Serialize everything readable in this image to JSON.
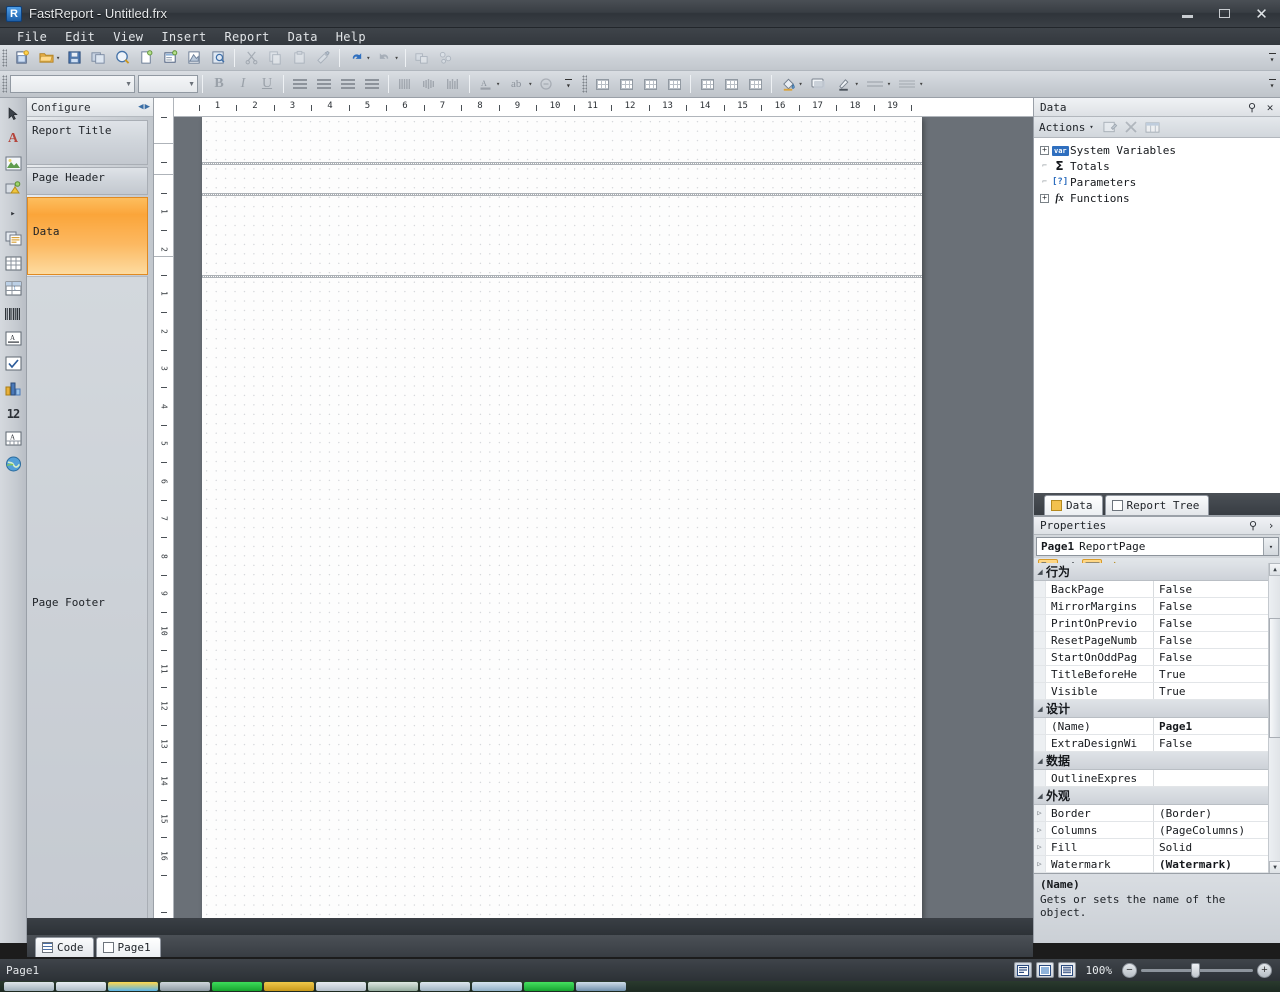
{
  "window": {
    "title": "FastReport - Untitled.frx",
    "app_icon": "R",
    "minimize_label": "Minimize",
    "maximize_label": "Maximize",
    "close_label": "✕"
  },
  "menubar": {
    "items": [
      {
        "label": "File"
      },
      {
        "label": "Edit"
      },
      {
        "label": "View"
      },
      {
        "label": "Insert"
      },
      {
        "label": "Report"
      },
      {
        "label": "Data"
      },
      {
        "label": "Help"
      }
    ]
  },
  "toolbar_main": {
    "buttons": [
      {
        "name": "new-report-button",
        "glyph": "▤"
      },
      {
        "name": "open-report-button",
        "glyph": "📂"
      },
      {
        "name": "open-dropdown-button",
        "glyph": "▾"
      },
      {
        "name": "save-report-button",
        "glyph": "💾"
      },
      {
        "name": "save-all-button",
        "glyph": "▤"
      },
      {
        "name": "preview-button",
        "glyph": "◐"
      },
      {
        "name": "new-page-button",
        "glyph": "▯"
      },
      {
        "name": "new-dialog-button",
        "glyph": "▤"
      },
      {
        "name": "page-setup-button",
        "glyph": "◺"
      },
      {
        "name": "report-settings-button",
        "glyph": "◎"
      },
      {
        "name": "cut-button",
        "glyph": "✂"
      },
      {
        "name": "copy-button",
        "glyph": "❐"
      },
      {
        "name": "paste-button",
        "glyph": "📋"
      },
      {
        "name": "format-painter-button",
        "glyph": "🖌"
      },
      {
        "name": "undo-button",
        "glyph": "↶"
      },
      {
        "name": "undo-dropdown-button",
        "glyph": "▾"
      },
      {
        "name": "redo-button",
        "glyph": "↷"
      },
      {
        "name": "redo-dropdown-button",
        "glyph": "▾"
      },
      {
        "name": "group-button",
        "glyph": "❏"
      },
      {
        "name": "ungroup-button",
        "glyph": "❖"
      }
    ],
    "overflow_label": "▾"
  },
  "toolbar_format": {
    "font_name": "",
    "font_name_placeholder": "",
    "font_size": "",
    "font_size_placeholder": "",
    "bold_label": "B",
    "italic_label": "I",
    "underline_label": "U",
    "align_left_label": "Align Left",
    "align_center_label": "Align Center",
    "align_right_label": "Align Right",
    "align_justify_label": "Justify",
    "valign_top_label": "Top",
    "valign_middle_label": "Middle",
    "valign_bottom_label": "Bottom",
    "font_color_label": "A",
    "style_label": "ab",
    "overflow_label": "▾"
  },
  "toolbar_frame": {
    "buttons": [
      {
        "name": "border-all-button"
      },
      {
        "name": "border-outside-button"
      },
      {
        "name": "border-inside-button"
      },
      {
        "name": "border-none-button"
      },
      {
        "name": "border-top-button"
      },
      {
        "name": "border-bottom-button"
      },
      {
        "name": "border-custom-button"
      }
    ],
    "fill_color_label": "Fill Color",
    "shadow_label": "Shadow",
    "line_color_label": "Line Color",
    "line_style_label": "Line Style",
    "line_width_label": "Line Width",
    "overflow_label": "▾"
  },
  "toolbox": {
    "tools": [
      {
        "name": "select-tool",
        "glyph": "➤",
        "selected": false
      },
      {
        "name": "text-object-tool",
        "glyph": "A",
        "selected": false
      },
      {
        "name": "picture-object-tool",
        "glyph": "▣",
        "selected": false
      },
      {
        "name": "shape-object-tool",
        "glyph": "◭",
        "selected": false
      },
      {
        "name": "line-object-tool",
        "glyph": "▸",
        "selected": false
      },
      {
        "name": "subreport-object-tool",
        "glyph": "❐",
        "selected": false
      },
      {
        "name": "table-object-tool",
        "glyph": "▦",
        "selected": false
      },
      {
        "name": "matrix-object-tool",
        "glyph": "▩",
        "selected": false
      },
      {
        "name": "barcode-object-tool",
        "glyph": "▥",
        "selected": false
      },
      {
        "name": "richtext-object-tool",
        "glyph": "Ａ",
        "selected": false
      },
      {
        "name": "checkbox-object-tool",
        "glyph": "✔",
        "selected": false
      },
      {
        "name": "chart-object-tool",
        "glyph": "▊",
        "selected": false
      },
      {
        "name": "zipcode-object-tool",
        "glyph": "12",
        "selected": false
      },
      {
        "name": "cellular-text-tool",
        "glyph": "Ⓐ",
        "selected": false
      },
      {
        "name": "map-object-tool",
        "glyph": "🌐",
        "selected": false
      }
    ]
  },
  "designer": {
    "band_panel_title": "Configure",
    "prev_arrow": "◀",
    "next_arrow": "▶",
    "bands": [
      {
        "name": "report-title-band",
        "label": "Report Title",
        "selected": false
      },
      {
        "name": "page-header-band",
        "label": "Page Header",
        "selected": false
      },
      {
        "name": "data-band",
        "label": "Data",
        "selected": true
      },
      {
        "name": "page-footer-band",
        "label": "Page Footer",
        "selected": false
      }
    ],
    "hruler_units": [
      1,
      2,
      3,
      4,
      5,
      6,
      7,
      8,
      9,
      10,
      11,
      12,
      13,
      14,
      15,
      16,
      17,
      18,
      19
    ],
    "vruler_units": [
      1,
      2,
      1,
      2,
      3,
      4,
      5,
      6,
      7,
      8,
      9,
      10,
      11,
      12,
      13,
      14,
      15,
      16
    ],
    "tabs": [
      {
        "name": "tab-code",
        "label": "Code",
        "icon": "code-icon",
        "active": false
      },
      {
        "name": "tab-page1",
        "label": "Page1",
        "icon": "page-icon",
        "active": true
      }
    ]
  },
  "data_panel": {
    "title": "Data",
    "pin_label": "⚲",
    "close_label": "✕",
    "actions_label": "Actions",
    "actions_caret": "▾",
    "action_buttons": [
      {
        "name": "edit-datasource-button",
        "glyph": "✎"
      },
      {
        "name": "delete-datasource-button",
        "glyph": "✕"
      },
      {
        "name": "view-data-button",
        "glyph": "▦"
      }
    ],
    "tree": [
      {
        "name": "node-system-variables",
        "label": "System Variables",
        "expander": "+",
        "icon": "var-badge-icon",
        "icon_text": "var"
      },
      {
        "name": "node-totals",
        "label": "Totals",
        "expander": "",
        "icon": "sigma-icon",
        "icon_text": "Σ"
      },
      {
        "name": "node-parameters",
        "label": "Parameters",
        "expander": "",
        "icon": "parameter-icon",
        "icon_text": "[?]"
      },
      {
        "name": "node-functions",
        "label": "Functions",
        "expander": "+",
        "icon": "function-icon",
        "icon_text": "fx"
      }
    ],
    "tabs": [
      {
        "name": "dock-tab-data",
        "label": "Data",
        "active": true
      },
      {
        "name": "dock-tab-report-tree",
        "label": "Report Tree",
        "active": false
      }
    ]
  },
  "properties_panel": {
    "title": "Properties",
    "pin_label": "⚲",
    "close_label": "›",
    "selected_object_name": "Page1",
    "selected_object_type": "ReportPage",
    "dropdown_label": "▾",
    "toolbar": [
      {
        "name": "categorized-view-button",
        "glyph": "▤",
        "active": true
      },
      {
        "name": "alphabetical-view-button",
        "glyph": "A↓",
        "active": false
      },
      {
        "name": "properties-view-button",
        "glyph": "▥",
        "active": true
      },
      {
        "name": "events-view-button",
        "glyph": "⚡",
        "active": false
      }
    ],
    "rows": [
      {
        "type": "category",
        "label": "行为"
      },
      {
        "type": "prop",
        "name": "BackPage",
        "value": "False",
        "expandable": false,
        "bold": false
      },
      {
        "type": "prop",
        "name": "MirrorMargins",
        "value": "False",
        "expandable": false,
        "bold": false
      },
      {
        "type": "prop",
        "name": "PrintOnPrevio",
        "value": "False",
        "expandable": false,
        "bold": false
      },
      {
        "type": "prop",
        "name": "ResetPageNumb",
        "value": "False",
        "expandable": false,
        "bold": false
      },
      {
        "type": "prop",
        "name": "StartOnOddPag",
        "value": "False",
        "expandable": false,
        "bold": false
      },
      {
        "type": "prop",
        "name": "TitleBeforeHe",
        "value": "True",
        "expandable": false,
        "bold": false
      },
      {
        "type": "prop",
        "name": "Visible",
        "value": "True",
        "expandable": false,
        "bold": false
      },
      {
        "type": "category",
        "label": "设计"
      },
      {
        "type": "prop",
        "name": "(Name)",
        "value": "Page1",
        "expandable": false,
        "bold": true
      },
      {
        "type": "prop",
        "name": "ExtraDesignWi",
        "value": "False",
        "expandable": false,
        "bold": false
      },
      {
        "type": "category",
        "label": "数据"
      },
      {
        "type": "prop",
        "name": "OutlineExpres",
        "value": "",
        "expandable": false,
        "bold": false
      },
      {
        "type": "category",
        "label": "外观"
      },
      {
        "type": "prop",
        "name": "Border",
        "value": "(Border)",
        "expandable": true,
        "bold": false
      },
      {
        "type": "prop",
        "name": "Columns",
        "value": "(PageColumns)",
        "expandable": true,
        "bold": false
      },
      {
        "type": "prop",
        "name": "Fill",
        "value": "Solid",
        "expandable": true,
        "bold": false
      },
      {
        "type": "prop",
        "name": "Watermark",
        "value": "(Watermark)",
        "expandable": true,
        "bold": true
      }
    ],
    "description_title": "(Name)",
    "description_text": "Gets or sets the name of the object."
  },
  "statusbar": {
    "text": "Page1",
    "zoom_level": "100%",
    "view_buttons": [
      {
        "name": "view-single-page-button",
        "glyph": "▤",
        "active": true
      },
      {
        "name": "view-two-page-button",
        "glyph": "▥",
        "active": false
      },
      {
        "name": "view-continuous-button",
        "glyph": "▦",
        "active": false
      }
    ],
    "zoom_out_label": "−",
    "zoom_in_label": "+"
  }
}
